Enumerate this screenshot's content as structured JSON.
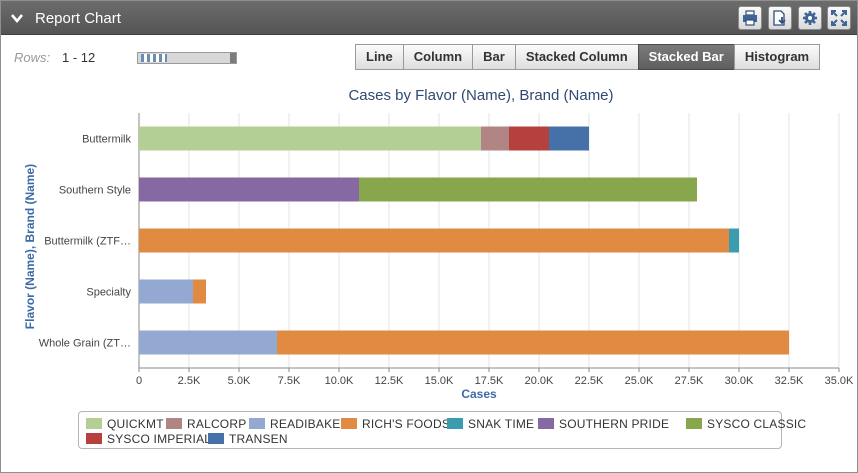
{
  "panel": {
    "title": "Report Chart",
    "toolbar_icons": [
      "print-icon",
      "export-icon",
      "settings-icon",
      "fullscreen-icon"
    ]
  },
  "rows": {
    "label": "Rows:",
    "value": "1 - 12"
  },
  "chart_types": [
    "Line",
    "Column",
    "Bar",
    "Stacked Column",
    "Stacked Bar",
    "Histogram"
  ],
  "active_chart_type": "Stacked Bar",
  "colors": {
    "QUICKMT": "#b3cf95",
    "RALCORP": "#b08583",
    "READIBAKE": "#93a9d1",
    "RICH'S FOODS": "#e08a42",
    "SNAK TIME": "#3b9cb0",
    "SOUTHERN PRIDE": "#8669a2",
    "SYSCO CLASSIC": "#88a64c",
    "SYSCO IMPERIAL": "#b5403d",
    "TRANSEN": "#4670a8"
  },
  "chart_data": {
    "type": "bar",
    "orientation": "horizontal",
    "stacked": true,
    "title": "Cases by Flavor (Name), Brand (Name)",
    "xlabel": "Cases",
    "ylabel": "Flavor (Name), Brand (Name)",
    "xlim": [
      0,
      35000
    ],
    "x_ticks": [
      "0",
      "2.5K",
      "5.0K",
      "7.5K",
      "10.0K",
      "12.5K",
      "15.0K",
      "17.5K",
      "20.0K",
      "22.5K",
      "25.0K",
      "27.5K",
      "30.0K",
      "32.5K",
      "35.0K"
    ],
    "categories": [
      "Buttermilk",
      "Southern Style",
      "Buttermilk (ZTF…",
      "Specialty",
      "Whole Grain (ZT…"
    ],
    "series": [
      {
        "name": "QUICKMT",
        "values": [
          17100,
          0,
          0,
          0,
          0
        ]
      },
      {
        "name": "RALCORP",
        "values": [
          1400,
          0,
          0,
          0,
          0
        ]
      },
      {
        "name": "READIBAKE",
        "values": [
          0,
          0,
          0,
          2700,
          6900
        ]
      },
      {
        "name": "RICH'S FOODS",
        "values": [
          0,
          0,
          29500,
          650,
          25600
        ]
      },
      {
        "name": "SNAK TIME",
        "values": [
          0,
          0,
          500,
          0,
          0
        ]
      },
      {
        "name": "SOUTHERN PRIDE",
        "values": [
          0,
          11000,
          0,
          0,
          0
        ]
      },
      {
        "name": "SYSCO CLASSIC",
        "values": [
          0,
          16900,
          0,
          0,
          0
        ]
      },
      {
        "name": "SYSCO IMPERIAL",
        "values": [
          2000,
          0,
          0,
          0,
          0
        ]
      },
      {
        "name": "TRANSEN",
        "values": [
          2000,
          0,
          0,
          0,
          0
        ]
      }
    ],
    "grid": true,
    "legend": "bottom"
  }
}
